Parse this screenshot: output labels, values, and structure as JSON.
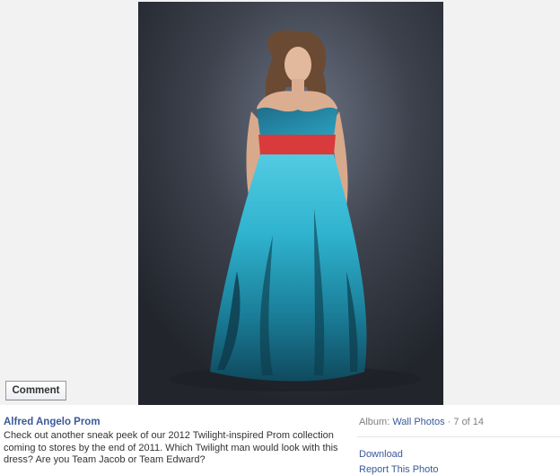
{
  "photo": {
    "alt": "Model in a strapless turquoise printed ball gown with a red sash"
  },
  "comment_button": {
    "label": "Comment"
  },
  "caption": {
    "owner": "Alfred Angelo Prom",
    "text": "Check out another sneak peek of our 2012 Twilight-inspired Prom collection coming to stores by the end of 2011. Which Twilight man would look with this dress? Are you Team Jacob or Team Edward?"
  },
  "album": {
    "label": "Album:",
    "name": "Wall Photos",
    "separator": " · ",
    "position": "7 of 14"
  },
  "actions": {
    "download": "Download",
    "report": "Report This Photo"
  },
  "colors": {
    "link": "#3b5998",
    "dress_turquoise": "#2fb3cf",
    "sash_red": "#d93a3c",
    "backdrop": "#3a3f4a"
  }
}
